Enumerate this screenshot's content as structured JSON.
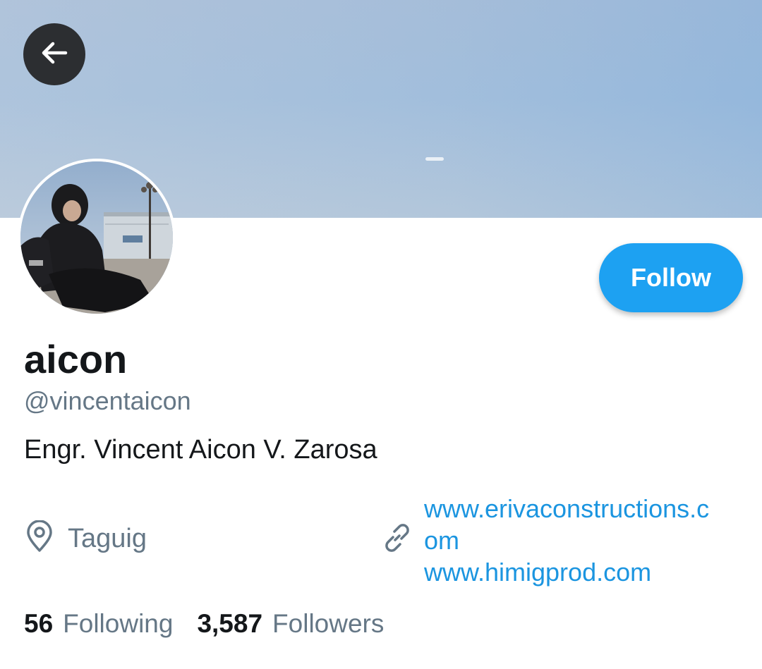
{
  "banner": {
    "colors": {
      "sky_top": "#a9bfd9",
      "sky_bottom": "#b9cadb"
    }
  },
  "nav": {
    "back_icon": "arrow-left-icon"
  },
  "profile": {
    "display_name": "aicon",
    "handle": "@vincentaicon",
    "bio": "Engr. Vincent Aicon V. Zarosa",
    "location": "Taguig",
    "location_icon": "map-pin-icon",
    "link_icon": "link-icon",
    "website_line_1": "www.erivaconstructions.c",
    "website_line_2": "om",
    "website_line_3": "www.himigprod.com"
  },
  "actions": {
    "follow_label": "Follow"
  },
  "stats": {
    "following_count": "56",
    "following_label": "Following",
    "followers_count": "3,587",
    "followers_label": "Followers"
  },
  "colors": {
    "accent": "#1da1f2",
    "link": "#1b95e0",
    "secondary_text": "#657786",
    "primary_text": "#14171a"
  }
}
